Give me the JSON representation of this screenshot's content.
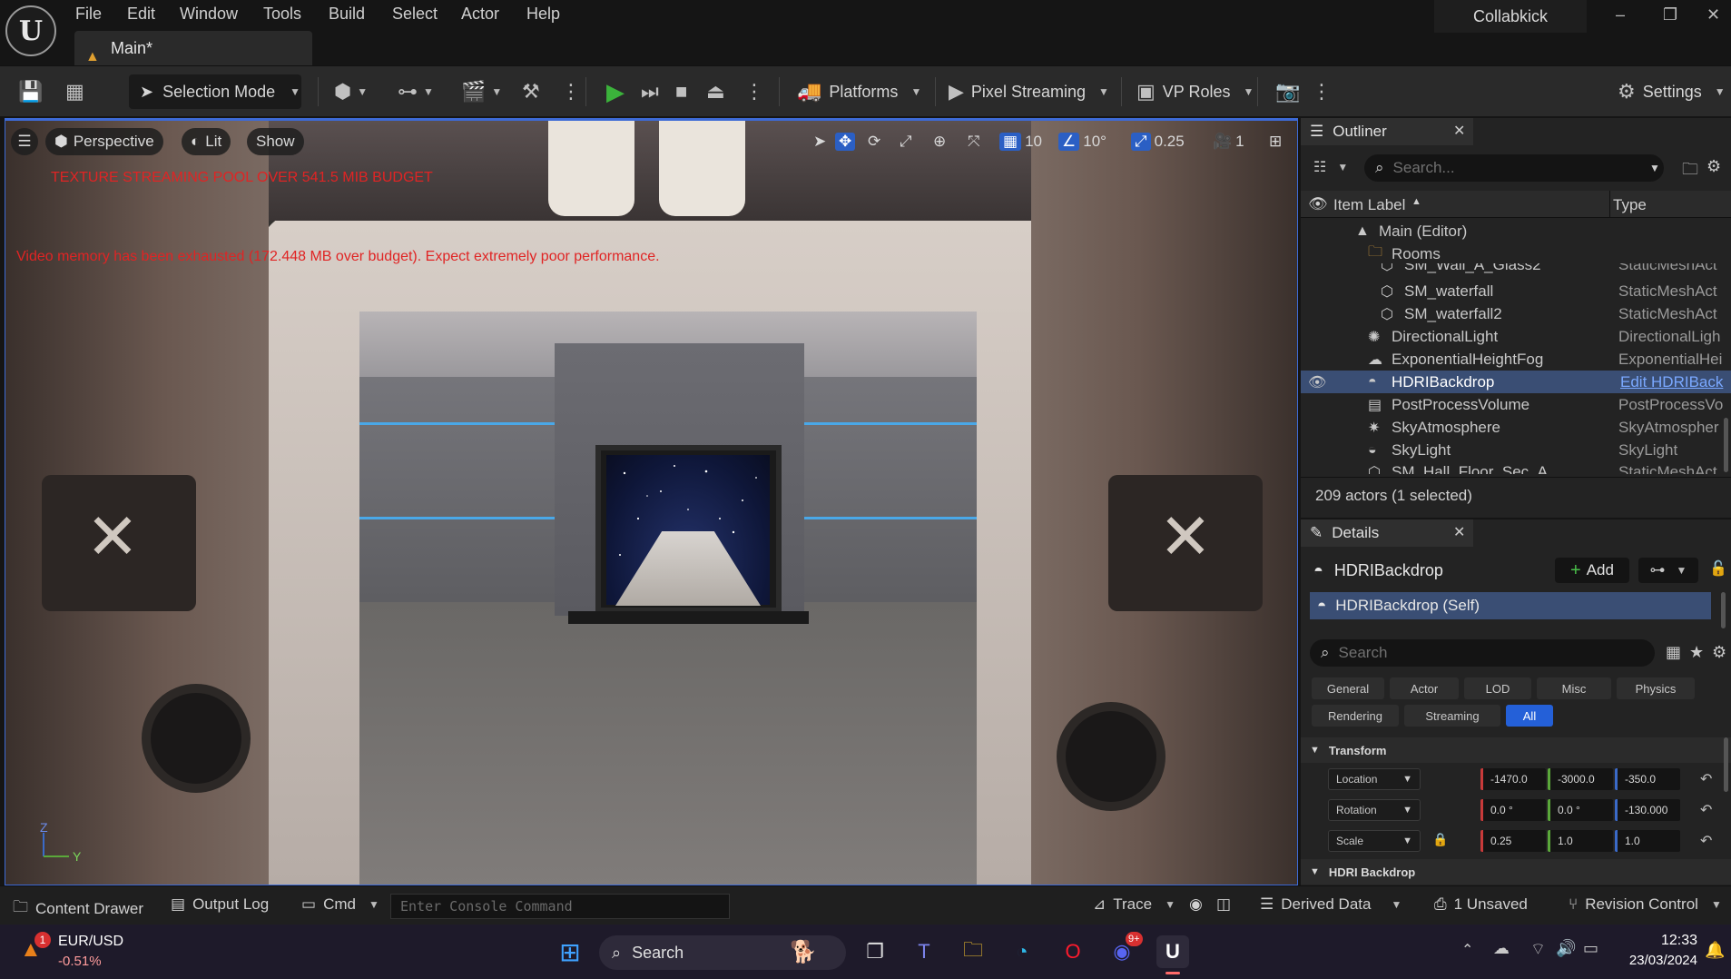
{
  "menu": [
    "File",
    "Edit",
    "Window",
    "Tools",
    "Build",
    "Select",
    "Actor",
    "Help"
  ],
  "tab": {
    "label": "Main*"
  },
  "project_name": "Collabkick",
  "window_controls": {
    "minimize": "–",
    "restore": "❐",
    "close": "✕"
  },
  "toolbar": {
    "selection_mode": "Selection Mode",
    "platforms": "Platforms",
    "pixel_streaming": "Pixel Streaming",
    "vp_roles": "VP Roles",
    "settings": "Settings"
  },
  "viewport": {
    "perspective": "Perspective",
    "lit": "Lit",
    "show": "Show",
    "grid_snap": "10",
    "angle_snap": "10°",
    "scale_snap": "0.25",
    "camera_speed": "1",
    "warning_texture": "TEXTURE STREAMING POOL OVER 541.5 MiB BUDGET",
    "warning_memory": "Video memory has been exhausted (172.448 MB over budget). Expect extremely poor performance.",
    "axis_z": "Z",
    "axis_y": "Y"
  },
  "outliner": {
    "title": "Outliner",
    "search_placeholder": "Search...",
    "col_label": "Item Label",
    "col_type": "Type",
    "rows": [
      {
        "label": "Main (Editor)",
        "type": ""
      },
      {
        "label": "Rooms",
        "type": ""
      },
      {
        "label": "SM_Wall_A_Glass2",
        "type": "StaticMeshAct"
      },
      {
        "label": "SM_waterfall",
        "type": "StaticMeshAct"
      },
      {
        "label": "SM_waterfall2",
        "type": "StaticMeshAct"
      },
      {
        "label": "DirectionalLight",
        "type": "DirectionalLigh"
      },
      {
        "label": "ExponentialHeightFog",
        "type": "ExponentialHei"
      },
      {
        "label": "HDRIBackdrop",
        "type": "Edit HDRIBack"
      },
      {
        "label": "PostProcessVolume",
        "type": "PostProcessVo"
      },
      {
        "label": "SkyAtmosphere",
        "type": "SkyAtmospher"
      },
      {
        "label": "SkyLight",
        "type": "SkyLight"
      },
      {
        "label": "SM_Hall_Floor_Sec_A",
        "type": "StaticMeshAct"
      }
    ],
    "footer": "209 actors (1 selected)"
  },
  "details": {
    "title": "Details",
    "actor_name": "HDRIBackdrop",
    "add_label": "Add",
    "self_label": "HDRIBackdrop (Self)",
    "search_placeholder": "Search",
    "filters": [
      "General",
      "Actor",
      "LOD",
      "Misc",
      "Physics",
      "Rendering",
      "Streaming",
      "All"
    ],
    "section_transform": "Transform",
    "section_hdri": "HDRI Backdrop",
    "location": {
      "label": "Location",
      "x": "-1470.0",
      "y": "-3000.0",
      "z": "-350.0"
    },
    "rotation": {
      "label": "Rotation",
      "x": "0.0 °",
      "y": "0.0 °",
      "z": "-130.000"
    },
    "scale": {
      "label": "Scale",
      "x": "0.25",
      "y": "1.0",
      "z": "1.0"
    }
  },
  "statusbar": {
    "content_drawer": "Content Drawer",
    "output_log": "Output Log",
    "cmd": "Cmd",
    "console_placeholder": "Enter Console Command",
    "trace": "Trace",
    "derived_data": "Derived Data",
    "unsaved": "1 Unsaved",
    "revision_control": "Revision Control"
  },
  "taskbar": {
    "ticker_name": "EUR/USD",
    "ticker_change": "-0.51%",
    "ticker_badge": "1",
    "search": "Search",
    "discord_badge": "9+",
    "time": "12:33",
    "date": "23/03/2024"
  },
  "colors": {
    "accent": "#2460d8",
    "selection": "#3a4e74",
    "play": "#3bb33b",
    "warning": "#e02424"
  }
}
